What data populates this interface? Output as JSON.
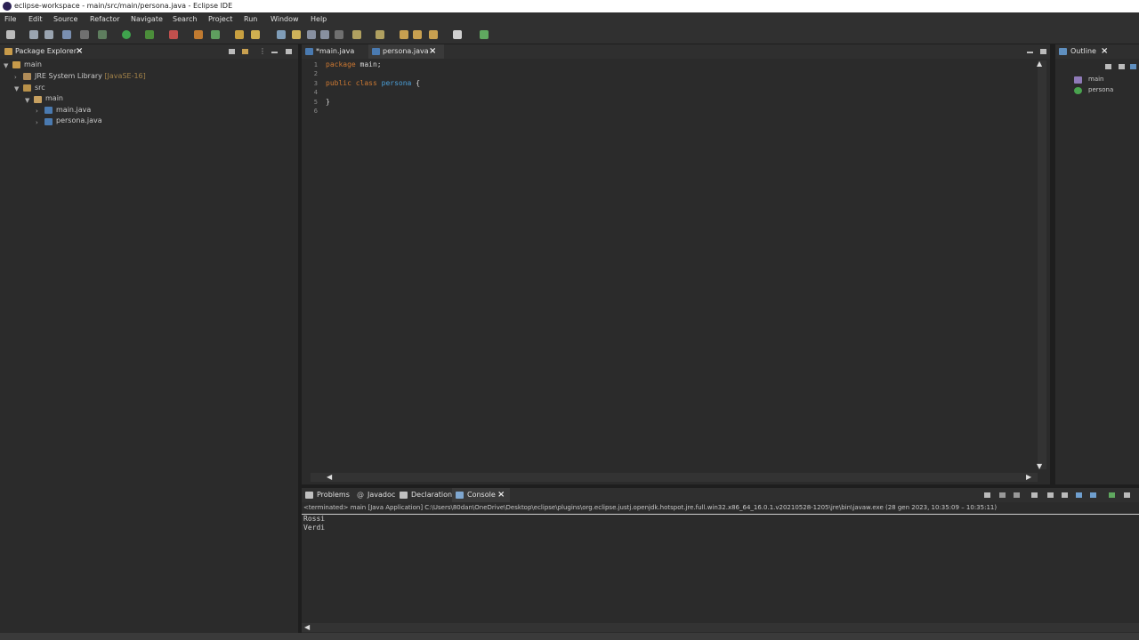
{
  "window": {
    "title": "eclipse-workspace - main/src/main/persona.java - Eclipse IDE"
  },
  "menu": [
    "File",
    "Edit",
    "Source",
    "Refactor",
    "Navigate",
    "Search",
    "Project",
    "Run",
    "Window",
    "Help"
  ],
  "package_explorer": {
    "title": "Package Explorer",
    "tree": {
      "project": "main",
      "jre_label": "JRE System Library",
      "jre_version": "[JavaSE-16]",
      "src": "src",
      "package": "main",
      "files": [
        "main.java",
        "persona.java"
      ]
    }
  },
  "editor": {
    "tabs": [
      {
        "label": "*main.java",
        "active": false
      },
      {
        "label": "persona.java",
        "active": true
      }
    ],
    "line_numbers": [
      "1",
      "2",
      "3",
      "4",
      "5",
      "6"
    ],
    "code": {
      "l1_kw": "package",
      "l1_rest": " main;",
      "l3_kw1": "public",
      "l3_kw2": "class",
      "l3_cls": "persona",
      "l3_brace": "{",
      "l5": "}"
    }
  },
  "outline": {
    "title": "Outline",
    "items": [
      "main",
      "persona"
    ]
  },
  "bottom": {
    "tabs": [
      "Problems",
      "Javadoc",
      "Declaration",
      "Console"
    ],
    "active_tab": "Console",
    "console_header": "<terminated> main [Java Application] C:\\Users\\80dan\\OneDrive\\Desktop\\eclipse\\plugins\\org.eclipse.justj.openjdk.hotspot.jre.full.win32.x86_64_16.0.1.v20210528-1205\\jre\\bin\\javaw.exe  (28 gen 2023, 10:35:09 – 10:35:11)",
    "output": [
      "Rossi",
      "Verdi"
    ]
  },
  "colors": {
    "keyword": "#cc7832",
    "class_name": "#4a9fd8",
    "background": "#2b2b2b"
  }
}
